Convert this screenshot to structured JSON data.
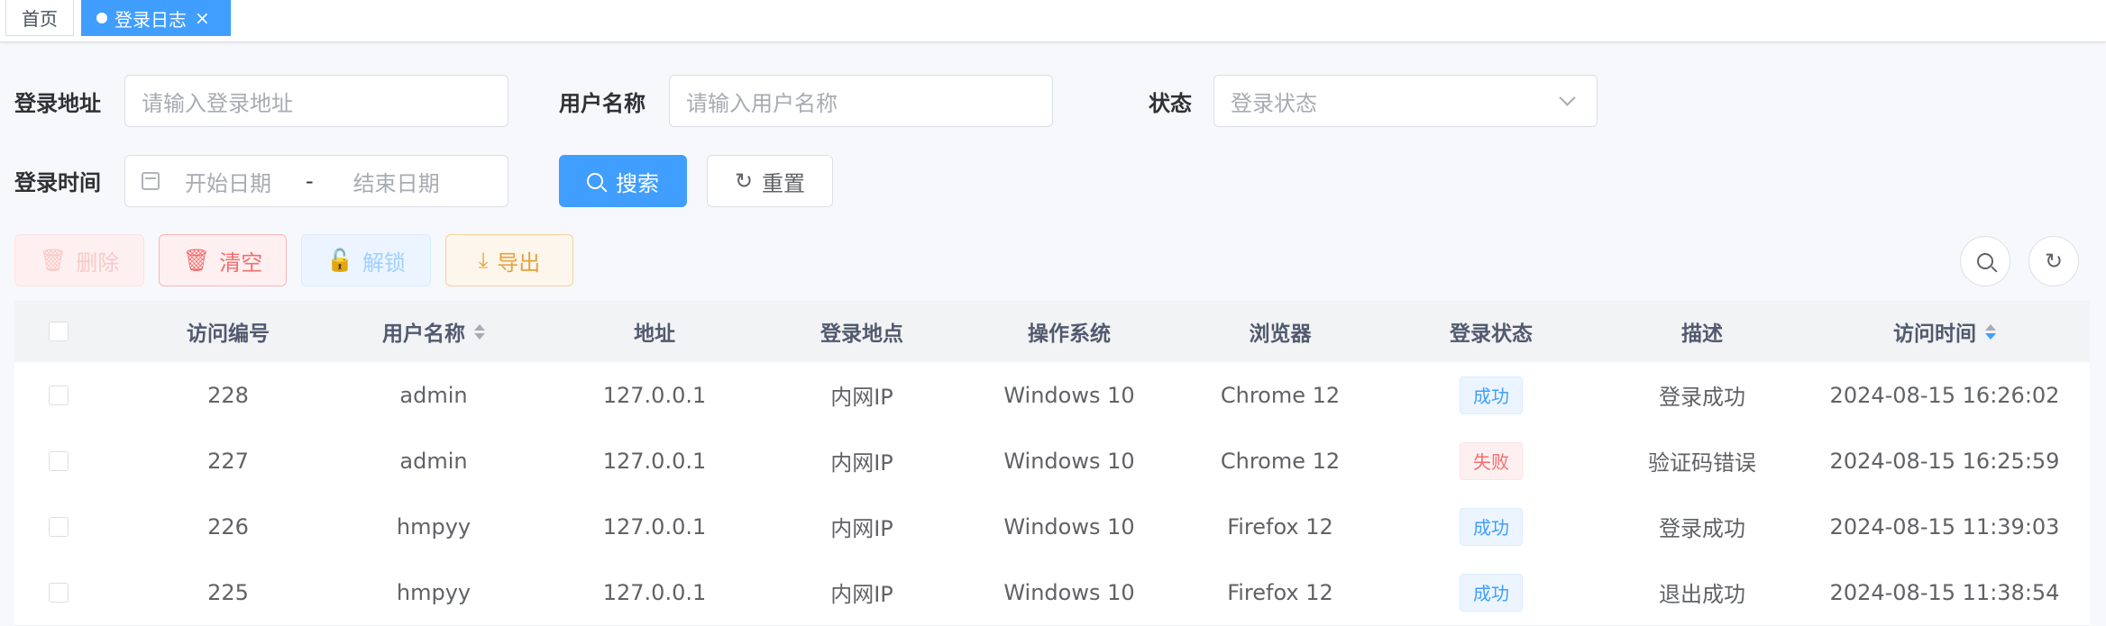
{
  "tags": {
    "home": "首页",
    "active": "登录日志",
    "close": "×"
  },
  "form": {
    "login_address": {
      "label": "登录地址",
      "placeholder": "请输入登录地址"
    },
    "user_name": {
      "label": "用户名称",
      "placeholder": "请输入用户名称"
    },
    "status": {
      "label": "状态",
      "placeholder": "登录状态"
    },
    "login_time": {
      "label": "登录时间",
      "start": "开始日期",
      "separator": "-",
      "end": "结束日期"
    },
    "search_label": "搜索",
    "reset_label": "重置"
  },
  "toolbar": {
    "delete": "删除",
    "clear": "清空",
    "unlock": "解锁",
    "export": "导出"
  },
  "table": {
    "columns": [
      "访问编号",
      "用户名称",
      "地址",
      "登录地点",
      "操作系统",
      "浏览器",
      "登录状态",
      "描述",
      "访问时间"
    ],
    "rows": [
      {
        "id": "228",
        "user": "admin",
        "ip": "127.0.0.1",
        "location": "内网IP",
        "os": "Windows 10",
        "browser": "Chrome 12",
        "status": "成功",
        "desc": "登录成功",
        "time": "2024-08-15 16:26:02"
      },
      {
        "id": "227",
        "user": "admin",
        "ip": "127.0.0.1",
        "location": "内网IP",
        "os": "Windows 10",
        "browser": "Chrome 12",
        "status": "失败",
        "desc": "验证码错误",
        "time": "2024-08-15 16:25:59"
      },
      {
        "id": "226",
        "user": "hmpyy",
        "ip": "127.0.0.1",
        "location": "内网IP",
        "os": "Windows 10",
        "browser": "Firefox 12",
        "status": "成功",
        "desc": "登录成功",
        "time": "2024-08-15 11:39:03"
      },
      {
        "id": "225",
        "user": "hmpyy",
        "ip": "127.0.0.1",
        "location": "内网IP",
        "os": "Windows 10",
        "browser": "Firefox 12",
        "status": "成功",
        "desc": "退出成功",
        "time": "2024-08-15 11:38:54"
      }
    ]
  },
  "colors": {
    "primary": "#409eff",
    "danger": "#f56c6c",
    "warning": "#e6a23c"
  },
  "icons": {
    "search": "search-icon",
    "refresh": "refresh-icon",
    "calendar": "calendar-icon",
    "trash": "trash-icon",
    "lock": "lock-icon",
    "download": "download-icon"
  }
}
